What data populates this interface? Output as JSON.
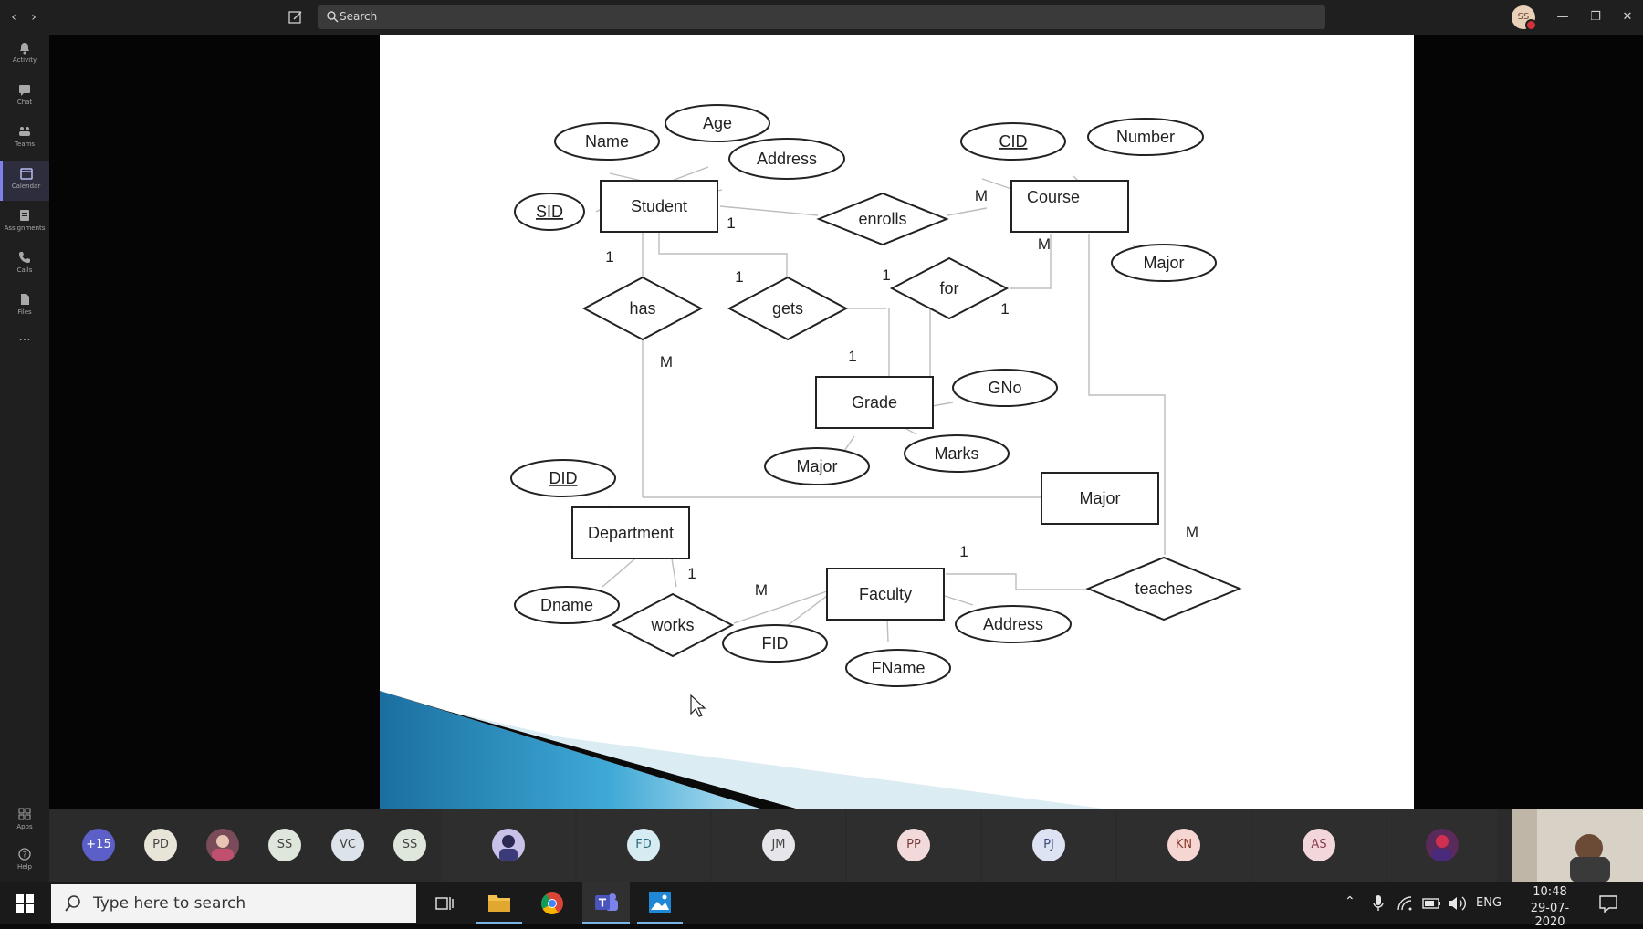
{
  "titlebar": {
    "search_placeholder": "Search",
    "user_initials": "SS",
    "nav": [
      "back-icon",
      "forward-icon"
    ],
    "window_controls": [
      "minimize-icon",
      "restore-icon",
      "close-icon"
    ]
  },
  "sidebar": {
    "items": [
      {
        "label": "Activity",
        "icon": "bell-icon"
      },
      {
        "label": "Chat",
        "icon": "chat-icon"
      },
      {
        "label": "Teams",
        "icon": "teams-icon"
      },
      {
        "label": "Calendar",
        "icon": "calendar-icon",
        "active": true
      },
      {
        "label": "Assignments",
        "icon": "assignments-icon"
      },
      {
        "label": "Calls",
        "icon": "phone-icon"
      },
      {
        "label": "Files",
        "icon": "file-icon"
      }
    ],
    "more_label": "···",
    "bottom": [
      {
        "label": "Apps",
        "icon": "apps-icon"
      },
      {
        "label": "Help",
        "icon": "help-icon"
      }
    ]
  },
  "diagram": {
    "entities": [
      "Student",
      "Course",
      "Grade",
      "Department",
      "Faculty",
      "Major"
    ],
    "relationships": [
      "enrolls",
      "has",
      "gets",
      "for",
      "works",
      "teaches"
    ],
    "attributes": {
      "student": [
        "Name",
        "Age",
        "Address",
        "SID"
      ],
      "course": [
        "CID",
        "Number",
        "Major"
      ],
      "grade": [
        "GNo",
        "Marks",
        "Major"
      ],
      "department": [
        "DID",
        "Dname"
      ],
      "faculty": [
        "FID",
        "FName",
        "Address"
      ]
    },
    "cardinality": {
      "student_enrolls": "1",
      "enrolls_course": "M",
      "student_has": "1",
      "has_major": "M",
      "student_gets": "1",
      "gets_grade": "1",
      "grade_for": "1",
      "for_course": "1",
      "course_for": "M",
      "department_works": "1",
      "works_faculty": "M",
      "faculty_teaches": "1",
      "teaches_course": "M"
    }
  },
  "participants": {
    "overflow": "+15",
    "small": [
      "PD",
      "SS",
      "VC",
      "SS"
    ],
    "tiles": [
      "FD",
      "JM",
      "PP",
      "PJ",
      "KN",
      "AS"
    ],
    "colors": {
      "overflow_bg": "#5b5fc7",
      "PD": "#e8e4d8",
      "SS": "#dfe6dc",
      "VC": "#dce3ea",
      "SS2": "#dfe6dc",
      "FD": "#d6ecf2",
      "JM": "#e6e6ea",
      "PP": "#f2dada",
      "PJ": "#dde3f2",
      "KN": "#f6d6d2",
      "AS": "#f2d6dc"
    }
  },
  "taskbar": {
    "search_placeholder": "Type here to search",
    "language": "ENG",
    "time": "10:48",
    "date": "29-07-2020"
  }
}
